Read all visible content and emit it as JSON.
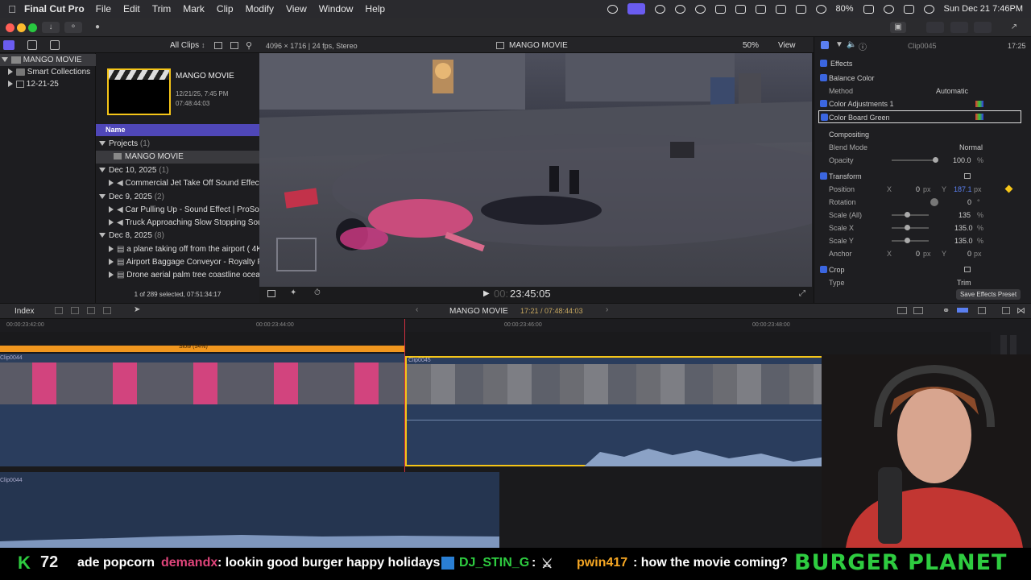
{
  "menubar": {
    "app_name": "Final Cut Pro",
    "items": [
      "File",
      "Edit",
      "Trim",
      "Mark",
      "Clip",
      "Modify",
      "View",
      "Window",
      "Help"
    ],
    "battery": "80%",
    "datetime": "Sun Dec 21  7:46PM"
  },
  "libraries": {
    "items": [
      {
        "label": "MANGO MOVIE"
      },
      {
        "label": "Smart Collections"
      },
      {
        "label": "12-21-25"
      }
    ]
  },
  "browser": {
    "filter": "All Clips",
    "project_title": "MANGO MOVIE",
    "project_date": "12/21/25, 7:45 PM",
    "project_duration": "07:48:44:03",
    "column_name": "Name",
    "rows": [
      {
        "label": "Projects",
        "count": "(1)"
      },
      {
        "label": "MANGO MOVIE",
        "count": ""
      },
      {
        "label": "Dec 10, 2025",
        "count": "(1)"
      },
      {
        "label": "Commercial Jet Take Off Sound Effect",
        "count": ""
      },
      {
        "label": "Dec 9, 2025",
        "count": "(2)"
      },
      {
        "label": "Car Pulling Up - Sound Effect  |  ProSoun",
        "count": ""
      },
      {
        "label": "Truck Approaching Slow Stopping Sound",
        "count": ""
      },
      {
        "label": "Dec 8, 2025",
        "count": "(8)"
      },
      {
        "label": "a plane taking off from the airport ( 4K ro",
        "count": ""
      },
      {
        "label": "Airport Baggage Conveyor - Royalty Free",
        "count": ""
      },
      {
        "label": "Drone aerial palm tree coastline ocean be",
        "count": ""
      }
    ],
    "status": "1 of 289 selected, 07:51:34:17"
  },
  "viewer": {
    "format": "4096 × 1716 | 24 fps, Stereo",
    "title": "MANGO MOVIE",
    "zoom": "50%",
    "view_menu": "View",
    "timecode_dim": "00:",
    "timecode": "23:45:05"
  },
  "inspector": {
    "clip_name": "Clip0045",
    "clip_time": "17:25",
    "effects_header": "Effects",
    "balance_color": "Balance Color",
    "method_label": "Method",
    "method_value": "Automatic",
    "color_adj": "Color Adjustments 1",
    "color_board": "Color Board Green",
    "compositing": "Compositing",
    "blend_label": "Blend Mode",
    "blend_value": "Normal",
    "opacity_label": "Opacity",
    "opacity_value": "100.0",
    "opacity_unit": "%",
    "transform": "Transform",
    "position_label": "Position",
    "pos_x_axis": "X",
    "pos_x": "0",
    "pos_x_unit": "px",
    "pos_y_axis": "Y",
    "pos_y": "187.1",
    "pos_y_unit": "px",
    "rotation_label": "Rotation",
    "rotation_value": "0",
    "rotation_unit": "°",
    "scale_all_label": "Scale (All)",
    "scale_all_value": "135",
    "scale_x_label": "Scale X",
    "scale_x_value": "135.0",
    "scale_y_label": "Scale Y",
    "scale_y_value": "135.0",
    "scale_unit": "%",
    "anchor_label": "Anchor",
    "anchor_x": "0",
    "anchor_y": "0",
    "crop": "Crop",
    "type_label": "Type",
    "type_value": "Trim",
    "save_preset": "Save Effects Preset"
  },
  "timeline": {
    "index": "Index",
    "project": "MANGO MOVIE",
    "duration": "17:21 / 07:48:44:03",
    "ruler_ticks": [
      "00:00:23:42:00",
      "00:00:23:44:00",
      "00:00:23:46:00",
      "00:00:23:48:00"
    ],
    "speed_label": "Slow (54%)",
    "clip_left": "Clip0044",
    "clip_right": "Clip0045",
    "audio_clip": "Clip0044"
  },
  "stream_overlay": {
    "counter_letter": "K",
    "counter_value": "72",
    "chat_1": "ade popcorn",
    "chat_user_2": "demandx",
    "chat_msg_2": ": lookin good burger happy holidays",
    "chat_user_3": "DJ_STIN_G",
    "chat_msg_3": ":",
    "chat_user_4": "pwin417",
    "chat_msg_4": ": how the movie coming?",
    "brand": "BURGER PLANET"
  },
  "colors": {
    "accent": "#5a4fd8",
    "selection": "#f5c518",
    "speed_bar": "#f0961e",
    "chat_user": "#e0457b",
    "brand": "#2ecc40"
  }
}
